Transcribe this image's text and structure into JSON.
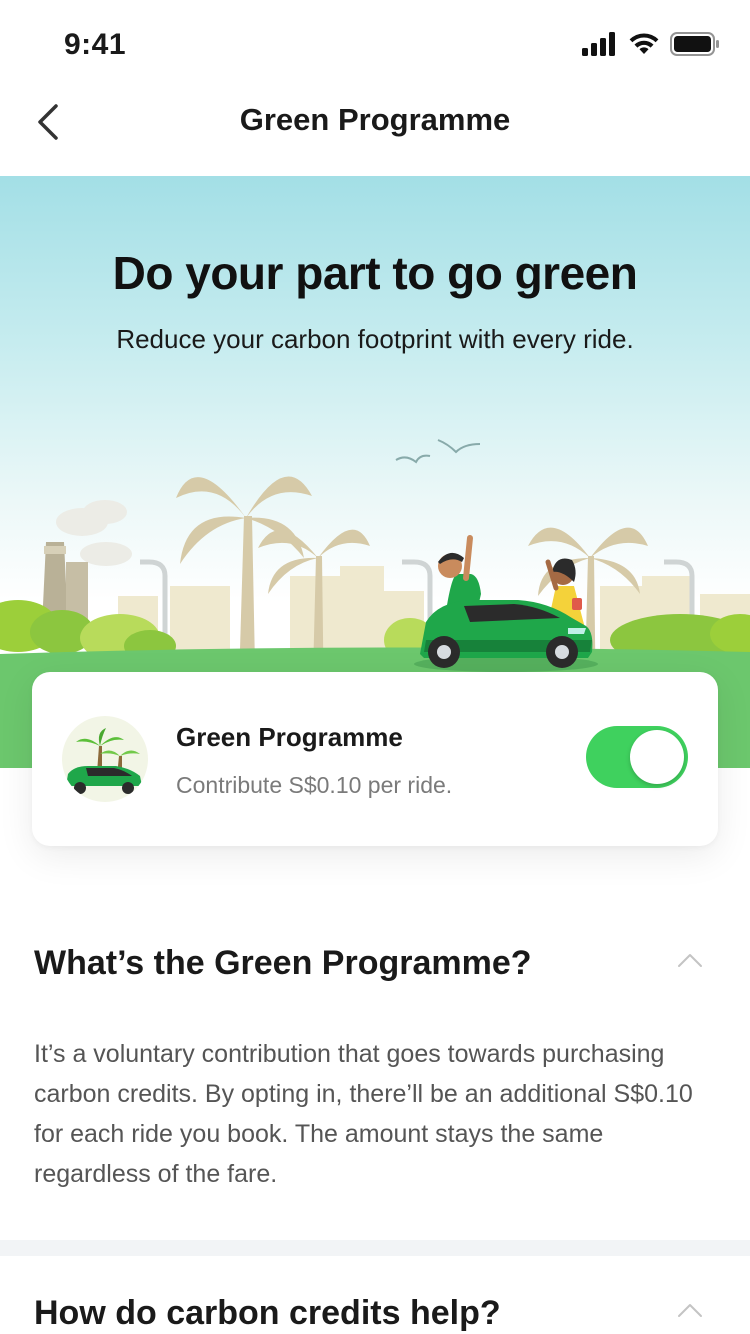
{
  "status_bar": {
    "time": "9:41"
  },
  "nav": {
    "title": "Green Programme"
  },
  "hero": {
    "title": "Do your part to go green",
    "subtitle": "Reduce your carbon footprint with every ride."
  },
  "card": {
    "title": "Green Programme",
    "subtitle": "Contribute S$0.10  per ride.",
    "toggle_on": true
  },
  "faq": [
    {
      "question": "What’s the Green Programme?",
      "answer": "It’s a voluntary contribution that goes towards purchasing carbon credits. By opting in, there’ll be an additional S$0.10 for each ride you book. The amount stays the same regardless of the fare."
    },
    {
      "question": "How do carbon credits help?"
    }
  ],
  "colors": {
    "accent_green": "#3fd15e",
    "car_green": "#1fa74a",
    "sky": "#a3dfe6"
  }
}
